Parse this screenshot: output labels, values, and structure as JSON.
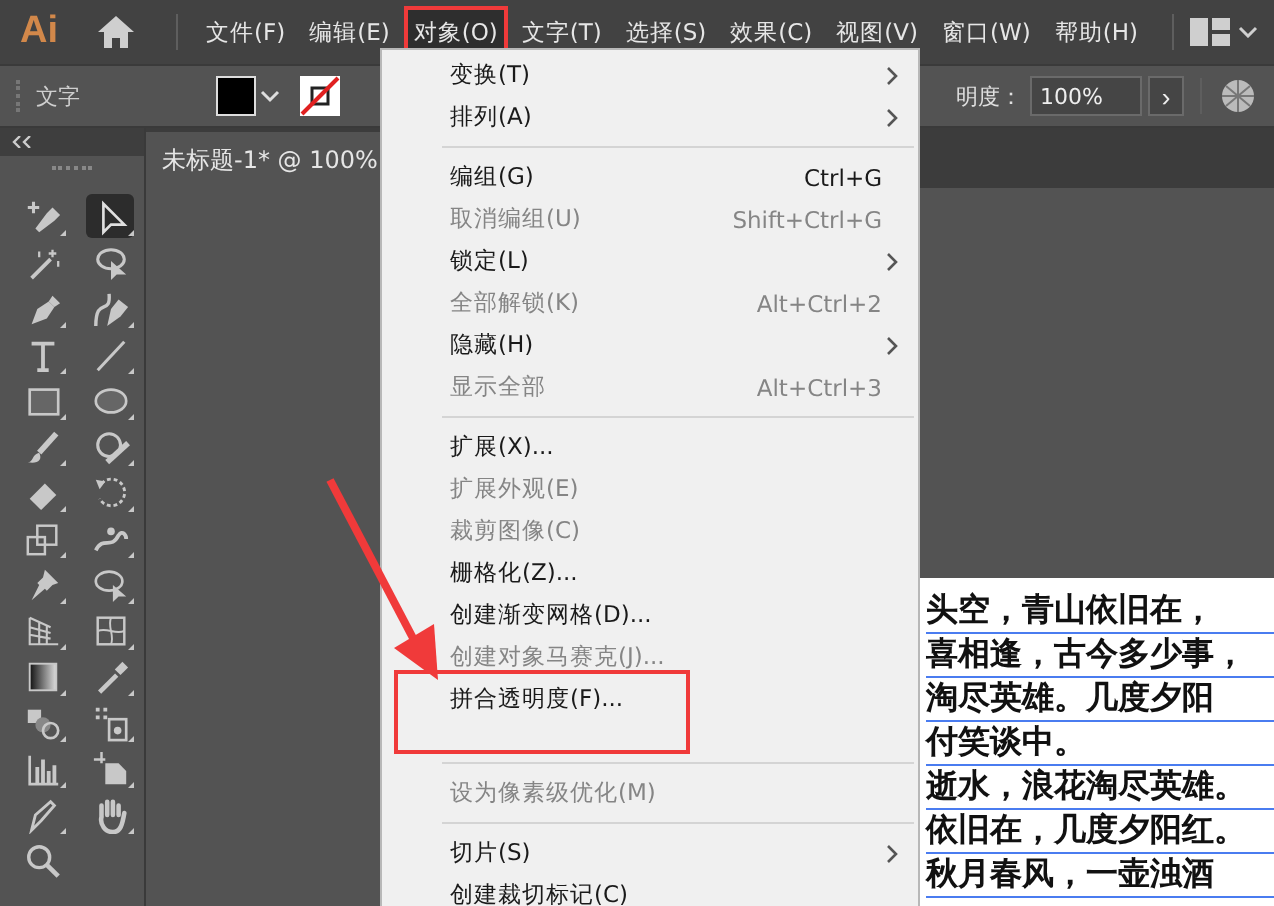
{
  "app": {
    "logo": "Ai"
  },
  "menu_bar": [
    {
      "label": "文件(F)",
      "selected": false
    },
    {
      "label": "编辑(E)",
      "selected": false
    },
    {
      "label": "对象(O)",
      "selected": true
    },
    {
      "label": "文字(T)",
      "selected": false
    },
    {
      "label": "选择(S)",
      "selected": false
    },
    {
      "label": "效果(C)",
      "selected": false
    },
    {
      "label": "视图(V)",
      "selected": false
    },
    {
      "label": "窗口(W)",
      "selected": false
    },
    {
      "label": "帮助(H)",
      "selected": false
    }
  ],
  "control_bar": {
    "label": "文字",
    "opacity_label": "明度：",
    "opacity_value": "100%",
    "next_button": "›"
  },
  "document_tab": {
    "title": "未标题-1* @ 100%"
  },
  "tools": [
    {
      "kind": "pen-add",
      "selected": false
    },
    {
      "kind": "arrow",
      "selected": true
    },
    {
      "kind": "wand",
      "selected": false
    },
    {
      "kind": "lasso",
      "selected": false
    },
    {
      "kind": "pen",
      "selected": false
    },
    {
      "kind": "curvature",
      "selected": false
    },
    {
      "kind": "type",
      "selected": false
    },
    {
      "kind": "line",
      "selected": false
    },
    {
      "kind": "rect",
      "selected": false
    },
    {
      "kind": "ellipse",
      "selected": false
    },
    {
      "kind": "brush",
      "selected": false
    },
    {
      "kind": "blob",
      "selected": false
    },
    {
      "kind": "eraser",
      "selected": false
    },
    {
      "kind": "rotate",
      "selected": false
    },
    {
      "kind": "scale",
      "selected": false
    },
    {
      "kind": "warp",
      "selected": false
    },
    {
      "kind": "pin",
      "selected": false
    },
    {
      "kind": "shape-builder",
      "selected": false
    },
    {
      "kind": "perspective",
      "selected": false
    },
    {
      "kind": "mesh",
      "selected": false
    },
    {
      "kind": "gradient",
      "selected": false
    },
    {
      "kind": "eyedropper",
      "selected": false
    },
    {
      "kind": "blend",
      "selected": false
    },
    {
      "kind": "spray",
      "selected": false
    },
    {
      "kind": "graph",
      "selected": false
    },
    {
      "kind": "artboard",
      "selected": false
    },
    {
      "kind": "slice",
      "selected": false
    },
    {
      "kind": "hand",
      "selected": false
    },
    {
      "kind": "zoom",
      "selected": false
    }
  ],
  "object_menu": [
    {
      "kind": "item",
      "label": "变换(T)",
      "submenu": true,
      "disabled": false
    },
    {
      "kind": "item",
      "label": "排列(A)",
      "submenu": true,
      "disabled": false
    },
    {
      "kind": "separator"
    },
    {
      "kind": "item",
      "label": "编组(G)",
      "shortcut": "Ctrl+G",
      "disabled": false
    },
    {
      "kind": "item",
      "label": "取消编组(U)",
      "shortcut": "Shift+Ctrl+G",
      "disabled": true
    },
    {
      "kind": "item",
      "label": "锁定(L)",
      "submenu": true,
      "disabled": false
    },
    {
      "kind": "item",
      "label": "全部解锁(K)",
      "shortcut": "Alt+Ctrl+2",
      "disabled": true
    },
    {
      "kind": "item",
      "label": "隐藏(H)",
      "submenu": true,
      "disabled": false
    },
    {
      "kind": "item",
      "label": "显示全部",
      "shortcut": "Alt+Ctrl+3",
      "disabled": true
    },
    {
      "kind": "separator"
    },
    {
      "kind": "item",
      "label": "扩展(X)...",
      "disabled": false
    },
    {
      "kind": "item",
      "label": "扩展外观(E)",
      "disabled": true
    },
    {
      "kind": "item",
      "label": "裁剪图像(C)",
      "disabled": true
    },
    {
      "kind": "item",
      "label": "栅格化(Z)...",
      "disabled": false
    },
    {
      "kind": "item",
      "label": "创建渐变网格(D)...",
      "disabled": false
    },
    {
      "kind": "item",
      "label": "创建对象马赛克(J)...",
      "disabled": true
    },
    {
      "kind": "item",
      "label": "拼合透明度(F)...",
      "disabled": false,
      "highlighted": true
    },
    {
      "kind": "separator"
    },
    {
      "kind": "item",
      "label": "设为像素级优化(M)",
      "disabled": true
    },
    {
      "kind": "separator"
    },
    {
      "kind": "item",
      "label": "切片(S)",
      "submenu": true,
      "disabled": false
    },
    {
      "kind": "item",
      "label": "创建裁切标记(C)",
      "disabled": false
    }
  ],
  "artboard_text": [
    "头空，青山依旧在，",
    "喜相逢，古今多少事，",
    "淘尽英雄。几度夕阳",
    "付笑谈中。",
    "逝水，浪花淘尽英雄。",
    "依旧在，几度夕阳红。",
    "秋月春风，一壶浊酒"
  ]
}
